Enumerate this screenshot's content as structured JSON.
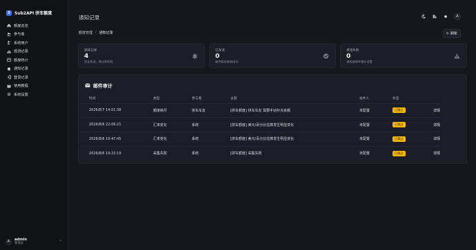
{
  "sidebar": {
    "brand": "Sub2API 拼车额度",
    "brand_logo": "S",
    "items": [
      {
        "label": "额度总览",
        "icon": "home-icon"
      },
      {
        "label": "参与者",
        "icon": "users-icon"
      },
      {
        "label": "系统用户",
        "icon": "user-admin-icon"
      },
      {
        "label": "观测记录",
        "icon": "bar-chart-icon"
      },
      {
        "label": "额度统计",
        "icon": "stats-card-icon"
      },
      {
        "label": "通知记录",
        "icon": "bell-icon"
      },
      {
        "label": "登录记录",
        "icon": "login-icon"
      },
      {
        "label": "使用教程",
        "icon": "book-icon"
      },
      {
        "label": "系统设置",
        "icon": "gear-icon"
      }
    ],
    "user": {
      "name": "admin",
      "role": "管理员",
      "avatar": "A"
    }
  },
  "header": {
    "title": "通知记录",
    "avatar": "A",
    "icons": [
      "moon-icon",
      "grid-icon",
      "dot-icon"
    ]
  },
  "breadcrumb": {
    "parent": "额度管理",
    "sep": "/",
    "current": "通知记录"
  },
  "refresh_label": "刷新",
  "stats": [
    {
      "label": "通知记录",
      "value": "4",
      "desc": "包含发送、跳过和失败",
      "icon": "bell-icon"
    },
    {
      "label": "已发送",
      "value": "0",
      "desc": "邮件服务接收成功",
      "icon": "check-circle-icon"
    },
    {
      "label": "发送失败",
      "value": "0",
      "desc": "请检查邮件服务设置",
      "icon": "warning-icon"
    }
  ],
  "audit": {
    "title": "邮件审计",
    "columns": [
      "时间",
      "类型",
      "参与者",
      "主题",
      "收件人",
      "状态",
      ""
    ],
    "rows": [
      {
        "time": "2026/8/7 14:01:38",
        "type": "额度耗尽",
        "participant": "拼车车友",
        "subject": "[拼车额度] 拼车车友 需要手动补充余额",
        "recipient": "未配置",
        "status": "已跳过",
        "action": "详情"
      },
      {
        "time": "2026/8/6 22:06:21",
        "type": "汇率变化",
        "participant": "系统",
        "subject": "[拼车额度] 美元/百分比估算发生明显变化",
        "recipient": "未配置",
        "status": "已跳过",
        "action": "详情"
      },
      {
        "time": "2026/8/6 19:47:45",
        "type": "汇率变化",
        "participant": "系统",
        "subject": "[拼车额度] 美元/百分比估算发生明显变化",
        "recipient": "未配置",
        "status": "已跳过",
        "action": "详情"
      },
      {
        "time": "2026/8/6 19:22:19",
        "type": "采集失败",
        "participant": "系统",
        "subject": "[拼车额度] 采集失败",
        "recipient": "未配置",
        "status": "已跳过",
        "action": "详情"
      }
    ]
  },
  "colors": {
    "accent": "#3b6cf5",
    "badge": "#f5b800",
    "background": "#15171c",
    "card": "#1b1e24"
  }
}
